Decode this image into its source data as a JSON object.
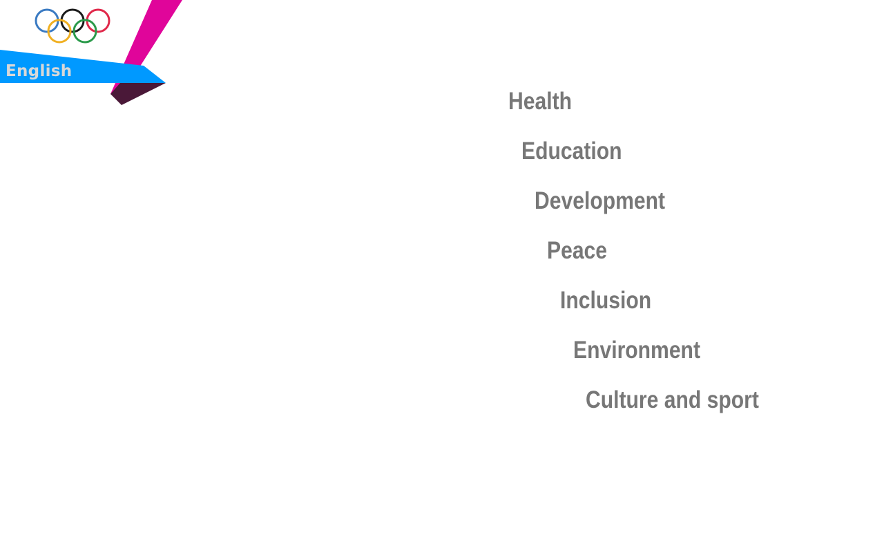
{
  "language": {
    "label": "English",
    "colors": {
      "banner": "#0099ff",
      "text": "#d8d8d8"
    }
  },
  "logo": {
    "name": "olympic-rings-icon",
    "ring_colors": [
      "#3a7ac2",
      "#1a1a1a",
      "#e0284a",
      "#f0b022",
      "#2a9a4a"
    ]
  },
  "ribbon": {
    "colors": {
      "magenta": "#e0059a",
      "dark": "#4a1838"
    }
  },
  "topics": [
    {
      "label": "Health"
    },
    {
      "label": "Education"
    },
    {
      "label": "Development"
    },
    {
      "label": "Peace"
    },
    {
      "label": "Inclusion"
    },
    {
      "label": "Environment"
    },
    {
      "label": "Culture and sport"
    }
  ],
  "colors": {
    "topic_text": "#777777",
    "background": "#ffffff"
  }
}
